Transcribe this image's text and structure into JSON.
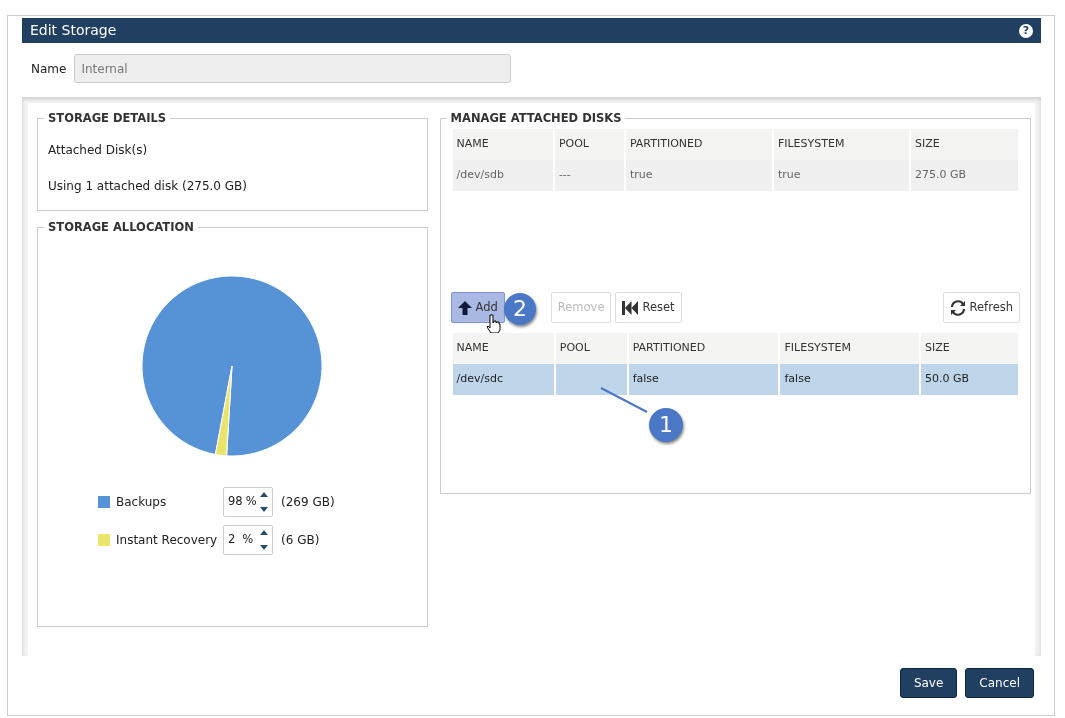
{
  "window": {
    "title": "Edit Storage",
    "help_icon": "?"
  },
  "name_field": {
    "label": "Name",
    "value": "Internal",
    "disabled": true
  },
  "storage_details": {
    "title": "STORAGE DETAILS",
    "lines": [
      "Attached Disk(s)",
      "Using 1 attached disk (275.0 GB)"
    ]
  },
  "storage_allocation": {
    "title": "STORAGE ALLOCATION",
    "chart_data": {
      "type": "pie",
      "values": [
        98,
        2
      ]
    },
    "items": [
      {
        "label": "Backups",
        "percent": "98",
        "unit": "%",
        "size": "(269 GB)",
        "color": "#5592d6"
      },
      {
        "label": "Instant Recovery",
        "percent": "2",
        "unit": "%",
        "size": "(6 GB)",
        "color": "#ebe46c"
      }
    ]
  },
  "manage_disks": {
    "title": "MANAGE ATTACHED DISKS",
    "attached_table": {
      "columns": [
        "NAME",
        "POOL",
        "PARTITIONED",
        "FILESYSTEM",
        "SIZE"
      ],
      "rows": [
        {
          "cells": [
            "/dev/sdb",
            "---",
            "true",
            "true",
            "275.0 GB"
          ],
          "selected": false
        }
      ]
    },
    "toolbar": [
      {
        "label": "Add",
        "kind": "add",
        "disabled": false,
        "hovered": true
      },
      {
        "label": "Remove",
        "kind": "remove",
        "disabled": true,
        "hovered": false
      },
      {
        "label": "Reset",
        "kind": "reset",
        "disabled": false,
        "hovered": false
      }
    ],
    "refresh_button": {
      "label": "Refresh"
    },
    "available_table": {
      "columns": [
        "NAME",
        "POOL",
        "PARTITIONED",
        "FILESYSTEM",
        "SIZE"
      ],
      "rows": [
        {
          "cells": [
            "/dev/sdc",
            "",
            "false",
            "false",
            "50.0 GB"
          ],
          "selected": true
        }
      ]
    }
  },
  "callouts": [
    "1",
    "2"
  ],
  "buttons": [
    "Save",
    "Cancel"
  ]
}
